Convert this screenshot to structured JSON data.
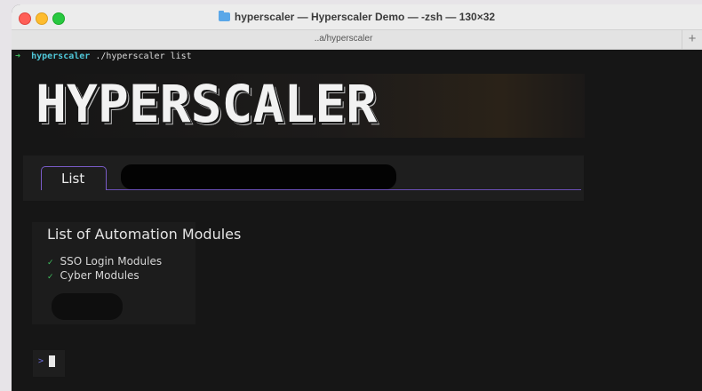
{
  "window": {
    "title": "hyperscaler — Hyperscaler Demo — -zsh — 130×32",
    "tab_path": "..a/hyperscaler",
    "new_tab_label": "+"
  },
  "terminal": {
    "prompt_arrow": "➜",
    "prompt_dir": "hyperscaler",
    "command": " ./hyperscaler list",
    "banner": "HYPERSCALER"
  },
  "app": {
    "tabs": [
      {
        "label": "List",
        "active": true
      }
    ],
    "section_title": "List of Automation Modules",
    "modules": [
      {
        "check": "✓",
        "label": "SSO Login Modules"
      },
      {
        "check": "✓",
        "label": "Cyber Modules"
      }
    ],
    "input_prompt": ">"
  },
  "colors": {
    "terminal_bg": "#161616",
    "accent_purple": "#7a5cc8",
    "prompt_green": "#3fbf5f",
    "dir_cyan": "#4fc7d8"
  }
}
